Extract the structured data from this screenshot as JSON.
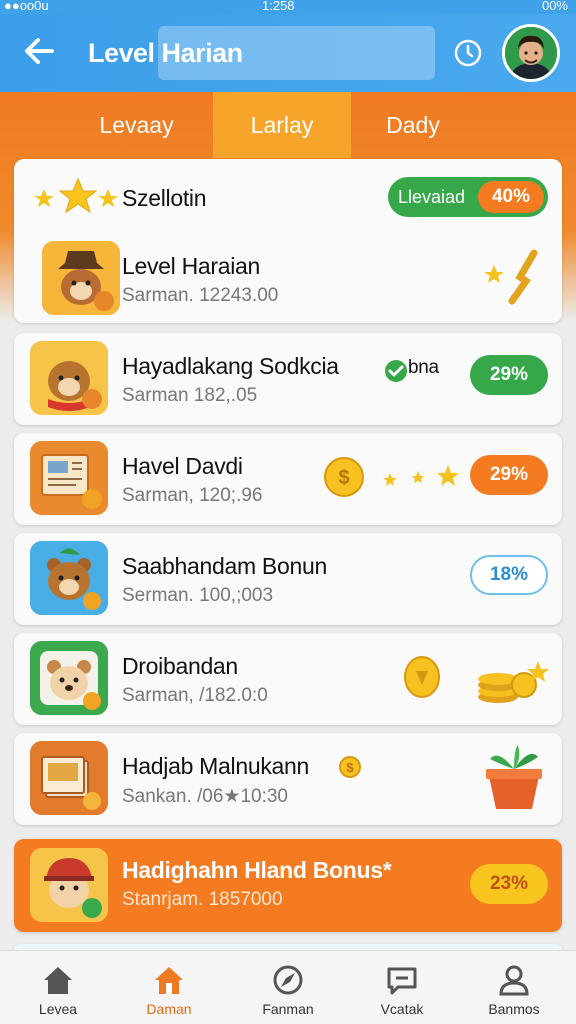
{
  "status_bar": {
    "left": "●●oo0u",
    "time": "1:258",
    "right": "00%"
  },
  "header": {
    "title": "Level Harian"
  },
  "tabs": [
    {
      "label": "Levaay"
    },
    {
      "label": "Larlay"
    },
    {
      "label": "Dady"
    }
  ],
  "summary": {
    "title": "Szellotin",
    "badge_label": "Llevaiad",
    "badge_value": "40%",
    "item_title": "Level Haraian",
    "item_sub": "Sarman. 12243.00"
  },
  "rows": [
    {
      "title": "Hayadlakang Sodkcia",
      "extra": "bna",
      "sub": "Sarman 182,.05",
      "badge": "29%"
    },
    {
      "title": "Havel Davdi",
      "sub": "Sarman, 120;.96",
      "badge": "29%"
    },
    {
      "title": "Saabhandam Bonun",
      "sub": "Serman. 100,;003",
      "badge": "18%"
    },
    {
      "title": "Droibandan",
      "sub": "Sarman, /182.0:0",
      "badge": ""
    },
    {
      "title": "Hadjab Malnukann",
      "sub": "Sankan. /06★10:30",
      "badge": ""
    },
    {
      "title": "Hadighahn Hland Bonus*",
      "sub": "Stanrjam. 1857000",
      "badge": "23%"
    }
  ],
  "nav": [
    {
      "label": "Levea",
      "icon": "home-icon"
    },
    {
      "label": "Daman",
      "icon": "home-icon"
    },
    {
      "label": "Fanman",
      "icon": "compass-icon"
    },
    {
      "label": "Vcatak",
      "icon": "chat-icon"
    },
    {
      "label": "Banmos",
      "icon": "profile-icon"
    }
  ],
  "colors": {
    "header_blue": "#3fa1ea",
    "orange": "#f07a22",
    "green": "#36a84a",
    "badge_orange": "#f47b20",
    "active_tab": "#f6a52a",
    "active_nav": "#f07a22"
  }
}
